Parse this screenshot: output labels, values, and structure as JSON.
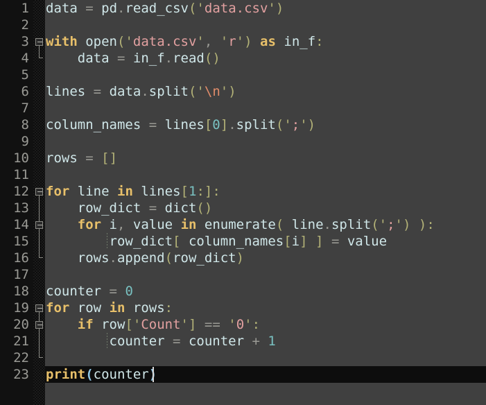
{
  "editor": {
    "language": "python",
    "total_lines": 23,
    "cursor": {
      "line": 23,
      "column": 16
    },
    "colors": {
      "background": "#404040",
      "gutter_background": "#111111",
      "fold_column_background": "#0d0d0d",
      "line_number": "#9a9a95",
      "current_line_highlight": "#0d0d0d",
      "keyword": "#e8c06a",
      "identifier": "#cfe6e8",
      "operator": "#9a9a94",
      "punctuation": "#b3b277",
      "string": "#e2a0a0",
      "escape": "#e08c6a",
      "number": "#79c0c0",
      "bracket_match": "#8fc8e8",
      "caret": "#d8d8d8",
      "fold_marker": "#8c8c86"
    },
    "line_numbers": [
      1,
      2,
      3,
      4,
      5,
      6,
      7,
      8,
      9,
      10,
      11,
      12,
      13,
      14,
      15,
      16,
      17,
      18,
      19,
      20,
      21,
      22,
      23
    ],
    "fold_markers": [
      {
        "line": 3,
        "state": "expanded",
        "spans_to": 4
      },
      {
        "line": 12,
        "state": "expanded",
        "spans_to": 16
      },
      {
        "line": 14,
        "state": "expanded",
        "spans_to": 15
      },
      {
        "line": 19,
        "state": "expanded",
        "spans_to": 22
      },
      {
        "line": 20,
        "state": "expanded",
        "spans_to": 21
      }
    ],
    "lines": [
      {
        "n": 1,
        "text": "data = pd.read_csv('data.csv')"
      },
      {
        "n": 2,
        "text": ""
      },
      {
        "n": 3,
        "text": "with open('data.csv', 'r') as in_f:"
      },
      {
        "n": 4,
        "text": "    data = in_f.read()"
      },
      {
        "n": 5,
        "text": ""
      },
      {
        "n": 6,
        "text": "lines = data.split('\\n')"
      },
      {
        "n": 7,
        "text": ""
      },
      {
        "n": 8,
        "text": "column_names = lines[0].split(';')"
      },
      {
        "n": 9,
        "text": ""
      },
      {
        "n": 10,
        "text": "rows = []"
      },
      {
        "n": 11,
        "text": ""
      },
      {
        "n": 12,
        "text": "for line in lines[1:]:"
      },
      {
        "n": 13,
        "text": "    row_dict = dict()"
      },
      {
        "n": 14,
        "text": "    for i, value in enumerate( line.split(';') ):"
      },
      {
        "n": 15,
        "text": "        row_dict[ column_names[i] ] = value"
      },
      {
        "n": 16,
        "text": "    rows.append(row_dict)"
      },
      {
        "n": 17,
        "text": ""
      },
      {
        "n": 18,
        "text": "counter = 0"
      },
      {
        "n": 19,
        "text": "for row in rows:"
      },
      {
        "n": 20,
        "text": "    if row['Count'] == '0':"
      },
      {
        "n": 21,
        "text": "        counter = counter + 1"
      },
      {
        "n": 22,
        "text": ""
      },
      {
        "n": 23,
        "text": "print(counter)"
      }
    ]
  }
}
